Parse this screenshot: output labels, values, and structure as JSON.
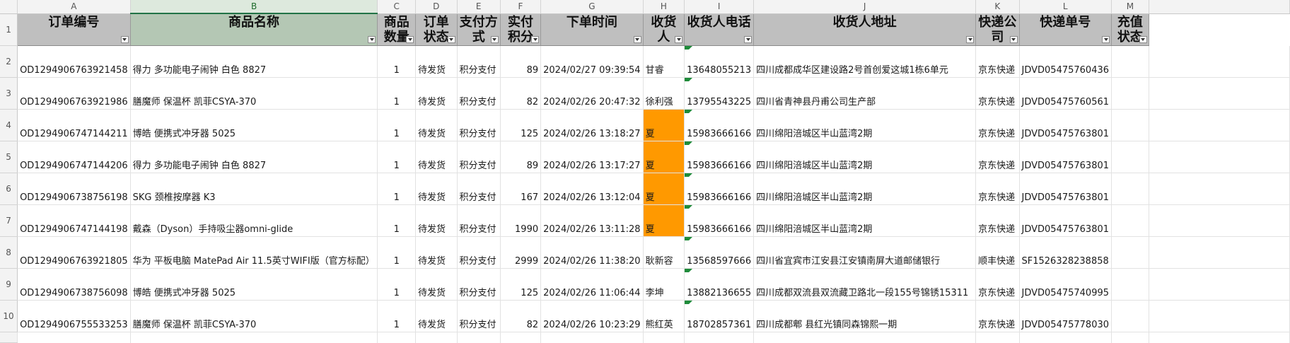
{
  "columns": [
    "A",
    "B",
    "C",
    "D",
    "E",
    "F",
    "G",
    "H",
    "I",
    "J",
    "K",
    "L",
    "M"
  ],
  "selected_column": "B",
  "row_numbers": [
    "1",
    "2",
    "3",
    "4",
    "5",
    "6",
    "7",
    "8",
    "9",
    "10"
  ],
  "headers": [
    "订单编号",
    "商品名称",
    "商品数量",
    "订单状态",
    "支付方式",
    "实付积分",
    "下单时间",
    "收货人",
    "收货人电话",
    "收货人地址",
    "快递公司",
    "快递单号",
    "充值状态"
  ],
  "rows": [
    {
      "order": "OD1294906763921458",
      "product": "得力 多功能电子闹钟 白色 8827",
      "qty": "1",
      "status": "待发货",
      "pay": "积分支付",
      "points": "89",
      "time": "2024/02/27 09:39:54",
      "name": "甘睿",
      "phone": "13648055213",
      "addr": "四川成都成华区建设路2号首创爱这城1栋6单元",
      "courier": "京东快递",
      "tracking": "JDVD05475760436",
      "recharge": ""
    },
    {
      "order": "OD1294906763921986",
      "product": "膳魔师 保温杯 凯菲CSYA-370",
      "qty": "1",
      "status": "待发货",
      "pay": "积分支付",
      "points": "82",
      "time": "2024/02/26 20:47:32",
      "name": "徐利强",
      "phone": "13795543225",
      "addr": "四川省青神县丹甫公司生产部",
      "courier": "京东快递",
      "tracking": "JDVD05475760561",
      "recharge": ""
    },
    {
      "order": "OD1294906747144211",
      "product": "博皓 便携式冲牙器 5025",
      "qty": "1",
      "status": "待发货",
      "pay": "积分支付",
      "points": "125",
      "time": "2024/02/26 13:18:27",
      "name": "夏",
      "phone": "15983666166",
      "addr": "四川绵阳涪城区半山蓝湾2期",
      "courier": "京东快递",
      "tracking": "JDVD05475763801",
      "recharge": ""
    },
    {
      "order": "OD1294906747144206",
      "product": "得力 多功能电子闹钟 白色 8827",
      "qty": "1",
      "status": "待发货",
      "pay": "积分支付",
      "points": "89",
      "time": "2024/02/26 13:17:27",
      "name": "夏",
      "phone": "15983666166",
      "addr": "四川绵阳涪城区半山蓝湾2期",
      "courier": "京东快递",
      "tracking": "JDVD05475763801",
      "recharge": ""
    },
    {
      "order": "OD1294906738756198",
      "product": "SKG 颈椎按摩器 K3",
      "qty": "1",
      "status": "待发货",
      "pay": "积分支付",
      "points": "167",
      "time": "2024/02/26 13:12:04",
      "name": "夏",
      "phone": "15983666166",
      "addr": "四川绵阳涪城区半山蓝湾2期",
      "courier": "京东快递",
      "tracking": "JDVD05475763801",
      "recharge": ""
    },
    {
      "order": "OD1294906747144198",
      "product": "戴森（Dyson）手持吸尘器omni-glide",
      "qty": "1",
      "status": "待发货",
      "pay": "积分支付",
      "points": "1990",
      "time": "2024/02/26 13:11:28",
      "name": "夏",
      "phone": "15983666166",
      "addr": "四川绵阳涪城区半山蓝湾2期",
      "courier": "京东快递",
      "tracking": "JDVD05475763801",
      "recharge": ""
    },
    {
      "order": "OD1294906763921805",
      "product": "华为 平板电脑 MatePad Air 11.5英寸WIFI版（官方标配）",
      "qty": "1",
      "status": "待发货",
      "pay": "积分支付",
      "points": "2999",
      "time": "2024/02/26 11:38:20",
      "name": "耿新容",
      "phone": "13568597666",
      "addr": "四川省宜宾市江安县江安镇南屏大道邮储银行",
      "courier": "顺丰快递",
      "tracking": "SF1526328238858",
      "recharge": ""
    },
    {
      "order": "OD1294906738756098",
      "product": "博皓 便携式冲牙器 5025",
      "qty": "1",
      "status": "待发货",
      "pay": "积分支付",
      "points": "125",
      "time": "2024/02/26 11:06:44",
      "name": "李坤",
      "phone": "13882136655",
      "addr": "四川成都双流县双流藏卫路北一段155号锦锈15311",
      "courier": "京东快递",
      "tracking": "JDVD05475740995",
      "recharge": ""
    },
    {
      "order": "OD1294906755533253",
      "product": "膳魔师 保温杯 凯菲CSYA-370",
      "qty": "1",
      "status": "待发货",
      "pay": "积分支付",
      "points": "82",
      "time": "2024/02/26 10:23:29",
      "name": "熊红英",
      "phone": "18702857361",
      "addr": "四川成都郫 县红光镇同森锦熙一期",
      "courier": "京东快递",
      "tracking": "JDVD05475778030",
      "recharge": ""
    }
  ],
  "highlight_color": "#ff9900",
  "highlighted_rows": [
    2,
    3,
    4,
    5
  ],
  "highlighted_field": "name"
}
